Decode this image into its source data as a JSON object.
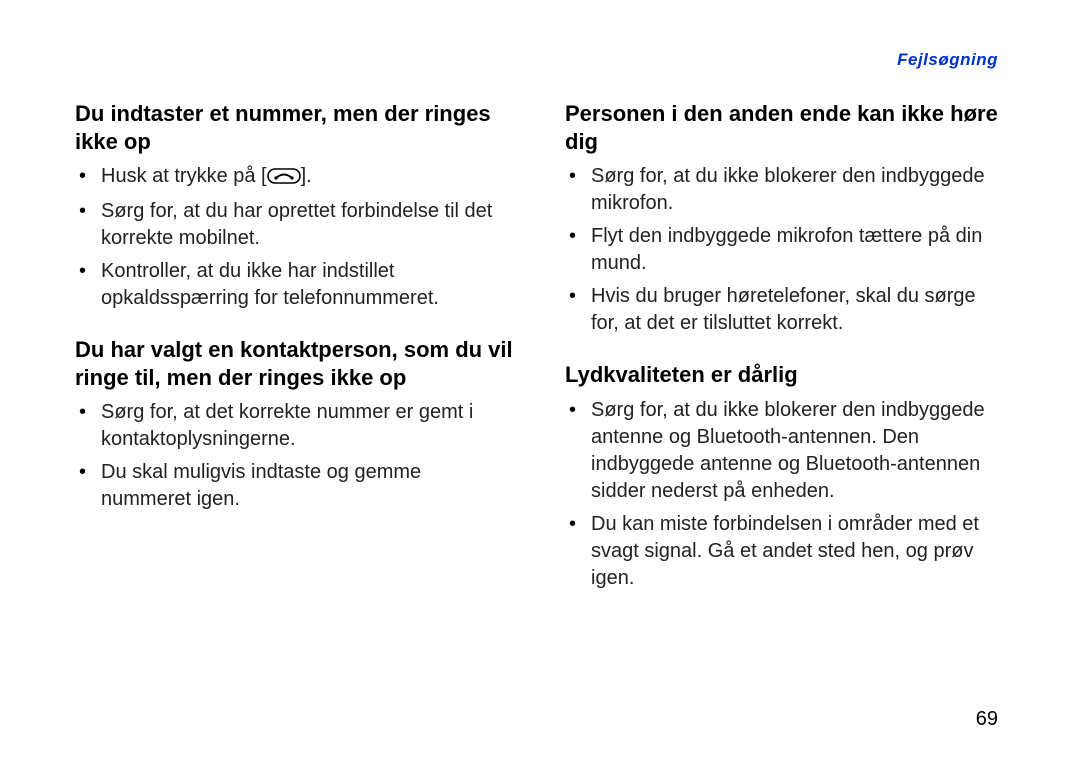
{
  "header": {
    "running_title": "Fejlsøgning"
  },
  "page_number": "69",
  "left_column": {
    "sections": [
      {
        "heading": "Du indtaster et nummer, men der ringes ikke op",
        "bullets": [
          {
            "pre": "Husk at trykke på [",
            "icon": "call-key-icon",
            "post": "]."
          },
          {
            "text": "Sørg for, at du har oprettet forbindelse til det korrekte mobilnet."
          },
          {
            "text": "Kontroller, at du ikke har indstillet opkaldsspærring for telefonnummeret."
          }
        ]
      },
      {
        "heading": "Du har valgt en kontaktperson, som du vil ringe til, men der ringes ikke op",
        "bullets": [
          {
            "text": "Sørg for, at det korrekte nummer er gemt i kontaktoplysningerne."
          },
          {
            "text": "Du skal muligvis indtaste og gemme nummeret igen."
          }
        ]
      }
    ]
  },
  "right_column": {
    "sections": [
      {
        "heading": "Personen i den anden ende kan ikke høre dig",
        "bullets": [
          {
            "text": "Sørg for, at du ikke blokerer den indbyggede mikrofon."
          },
          {
            "text": "Flyt den indbyggede mikrofon tættere på din mund."
          },
          {
            "text": "Hvis du bruger høretelefoner, skal du sørge for, at det er tilsluttet korrekt."
          }
        ]
      },
      {
        "heading": "Lydkvaliteten er dårlig",
        "bullets": [
          {
            "text": "Sørg for, at du ikke blokerer den indbyggede antenne og Bluetooth-antennen. Den indbyggede antenne og Bluetooth-antennen sidder nederst på enheden."
          },
          {
            "text": "Du kan miste forbindelsen i områder med et svagt signal. Gå et andet sted hen, og prøv igen."
          }
        ]
      }
    ]
  }
}
